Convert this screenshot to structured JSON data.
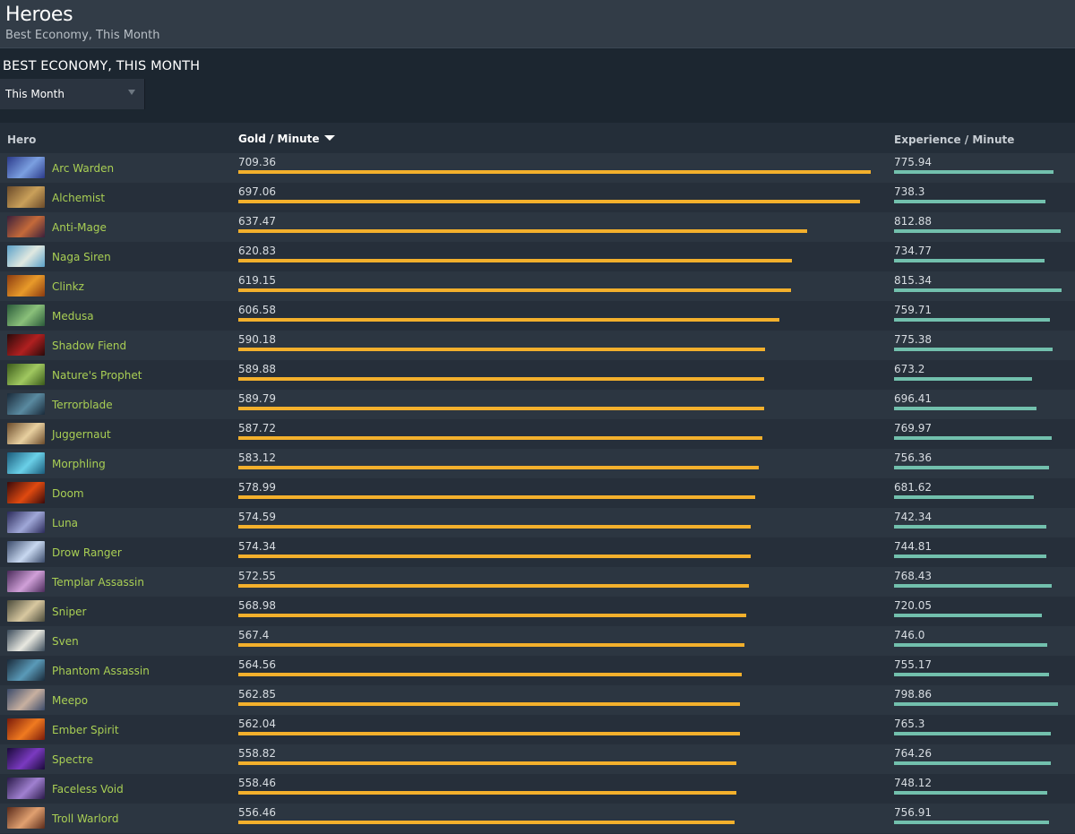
{
  "header": {
    "title": "Heroes",
    "subtitle": "Best Economy, This Month"
  },
  "section": {
    "title": "BEST ECONOMY, THIS MONTH",
    "dropdown_value": "This Month"
  },
  "table": {
    "columns": {
      "hero": "Hero",
      "gpm": "Gold / Minute",
      "xpm": "Experience / Minute"
    },
    "rows": [
      {
        "hero": "Arc Warden",
        "gpm": "709.36",
        "xpm": "775.94",
        "colors": [
          "#2b3a8a",
          "#7b9fe0"
        ]
      },
      {
        "hero": "Alchemist",
        "gpm": "697.06",
        "xpm": "738.3",
        "colors": [
          "#6a4a2a",
          "#c9a05a"
        ]
      },
      {
        "hero": "Anti-Mage",
        "gpm": "637.47",
        "xpm": "812.88",
        "colors": [
          "#3c1f3a",
          "#c46a3a"
        ]
      },
      {
        "hero": "Naga Siren",
        "gpm": "620.83",
        "xpm": "734.77",
        "colors": [
          "#5aa0c8",
          "#e0e8e0"
        ]
      },
      {
        "hero": "Clinkz",
        "gpm": "619.15",
        "xpm": "815.34",
        "colors": [
          "#8a3a10",
          "#e89a2a"
        ]
      },
      {
        "hero": "Medusa",
        "gpm": "606.58",
        "xpm": "759.71",
        "colors": [
          "#2a5a3a",
          "#8ac07a"
        ]
      },
      {
        "hero": "Shadow Fiend",
        "gpm": "590.18",
        "xpm": "775.38",
        "colors": [
          "#2a0a0a",
          "#b02020"
        ]
      },
      {
        "hero": "Nature's Prophet",
        "gpm": "589.88",
        "xpm": "673.2",
        "colors": [
          "#3a5a1a",
          "#a0c860"
        ]
      },
      {
        "hero": "Terrorblade",
        "gpm": "589.79",
        "xpm": "696.41",
        "colors": [
          "#1a2a3a",
          "#5a8aa0"
        ]
      },
      {
        "hero": "Juggernaut",
        "gpm": "587.72",
        "xpm": "769.97",
        "colors": [
          "#6a4a2a",
          "#e8d0a0"
        ]
      },
      {
        "hero": "Morphling",
        "gpm": "583.12",
        "xpm": "756.36",
        "colors": [
          "#1a5a7a",
          "#6ad0e8"
        ]
      },
      {
        "hero": "Doom",
        "gpm": "578.99",
        "xpm": "681.62",
        "colors": [
          "#3a0a0a",
          "#e04a10"
        ]
      },
      {
        "hero": "Luna",
        "gpm": "574.59",
        "xpm": "742.34",
        "colors": [
          "#2a2a5a",
          "#a0a8d8"
        ]
      },
      {
        "hero": "Drow Ranger",
        "gpm": "574.34",
        "xpm": "744.81",
        "colors": [
          "#3a4a6a",
          "#c8d8f0"
        ]
      },
      {
        "hero": "Templar Assassin",
        "gpm": "572.55",
        "xpm": "768.43",
        "colors": [
          "#4a2a5a",
          "#d0a0d8"
        ]
      },
      {
        "hero": "Sniper",
        "gpm": "568.98",
        "xpm": "720.05",
        "colors": [
          "#4a4a3a",
          "#d8c8a0"
        ]
      },
      {
        "hero": "Sven",
        "gpm": "567.4",
        "xpm": "746.0",
        "colors": [
          "#3a4a5a",
          "#e8e8e0"
        ]
      },
      {
        "hero": "Phantom Assassin",
        "gpm": "564.56",
        "xpm": "755.17",
        "colors": [
          "#1a2a3a",
          "#5a9ab8"
        ]
      },
      {
        "hero": "Meepo",
        "gpm": "562.85",
        "xpm": "798.86",
        "colors": [
          "#3a4a6a",
          "#c8b0a0"
        ]
      },
      {
        "hero": "Ember Spirit",
        "gpm": "562.04",
        "xpm": "765.3",
        "colors": [
          "#7a1a0a",
          "#f07a20"
        ]
      },
      {
        "hero": "Spectre",
        "gpm": "558.82",
        "xpm": "764.26",
        "colors": [
          "#1a0a3a",
          "#7a3ac0"
        ]
      },
      {
        "hero": "Faceless Void",
        "gpm": "558.46",
        "xpm": "748.12",
        "colors": [
          "#2a1a4a",
          "#a080d0"
        ]
      },
      {
        "hero": "Troll Warlord",
        "gpm": "556.46",
        "xpm": "756.91",
        "colors": [
          "#5a2a1a",
          "#e0a070"
        ]
      }
    ],
    "gpm_bar_max": 712,
    "xpm_bar_max": 830,
    "colors": {
      "gold_bar": "#f3b02c",
      "xp_bar": "#72c0ad",
      "hero_link": "#a9cf54"
    }
  }
}
